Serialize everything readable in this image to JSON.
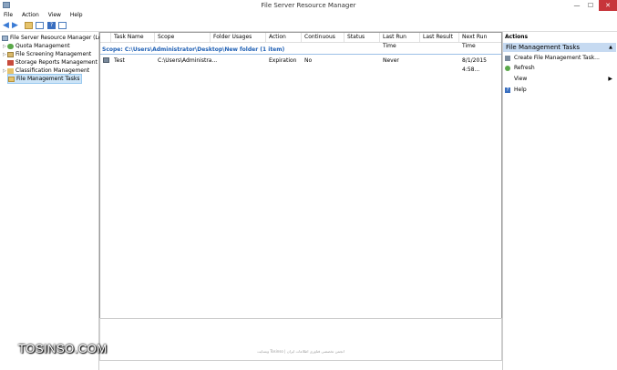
{
  "window": {
    "title": "File Server Resource Manager",
    "minimize": "—",
    "maximize": "☐",
    "close": "✕"
  },
  "menu": [
    "File",
    "Action",
    "View",
    "Help"
  ],
  "tree": {
    "root": "File Server Resource Manager (Local)",
    "items": [
      {
        "label": "Quota Management"
      },
      {
        "label": "File Screening Management"
      },
      {
        "label": "Storage Reports Management"
      },
      {
        "label": "Classification Management"
      },
      {
        "label": "File Management Tasks"
      }
    ]
  },
  "table": {
    "columns": [
      "Task Name",
      "Scope",
      "Folder Usages",
      "Action",
      "Continuous",
      "Status",
      "Last Run Time",
      "Last Result",
      "Next Run Time"
    ],
    "group": "Scope: C:\\Users\\Administrator\\Desktop\\New folder (1 item)",
    "rows": [
      {
        "task_name": "Test",
        "scope": "C:\\Users\\Administra...",
        "folder_usages": "",
        "action": "Expiration",
        "continuous": "No",
        "status": "",
        "last_run_time": "Never",
        "last_result": "",
        "next_run_time": "8/1/2015 4:58..."
      }
    ]
  },
  "footer_text": "وبسایت Tosinso | انجمن تخصصی فناوری اطلاعات ایران",
  "actions": {
    "title": "Actions",
    "section": "File Management Tasks",
    "items": [
      {
        "label": "Create File Management Task..."
      },
      {
        "label": "Refresh"
      },
      {
        "label": "View"
      },
      {
        "label": "Help"
      }
    ]
  },
  "watermark": "TOSINSO.COM"
}
